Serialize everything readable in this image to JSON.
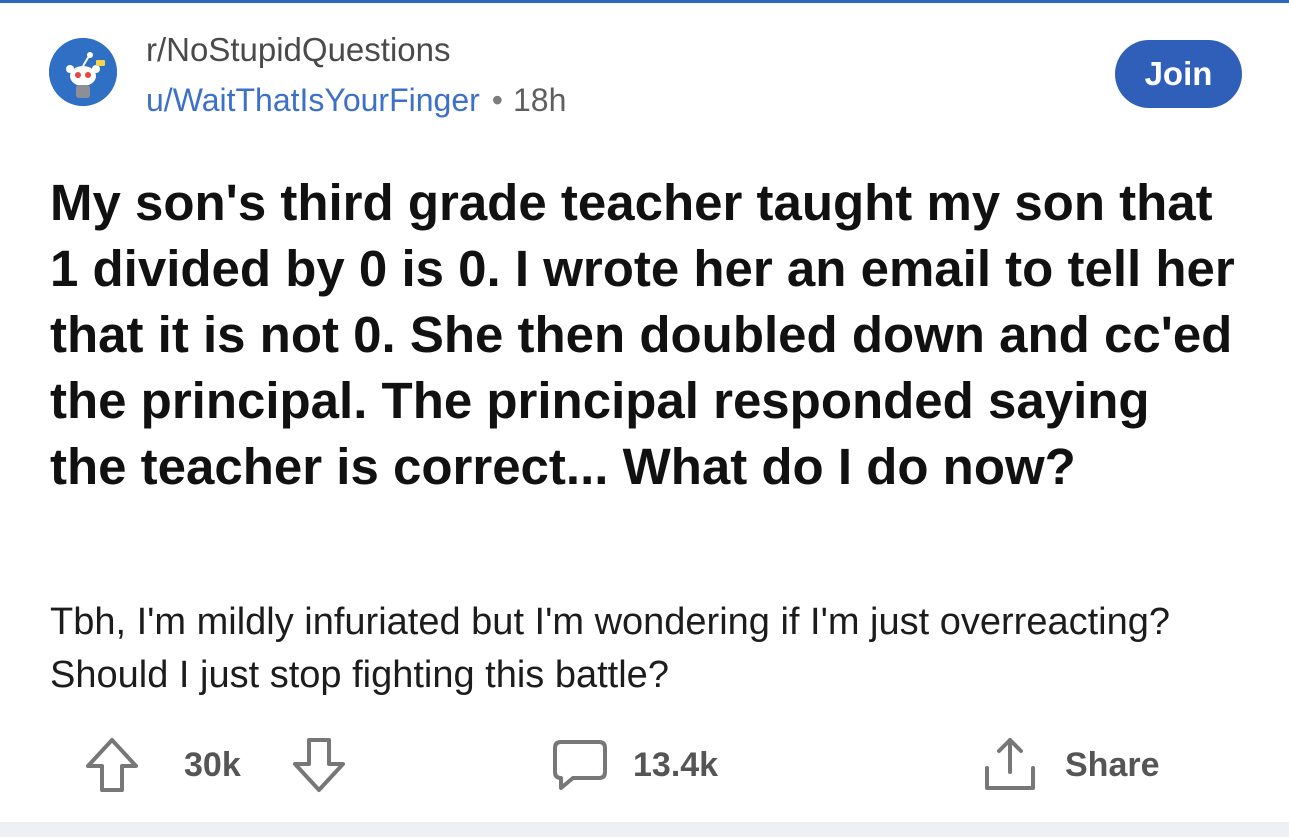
{
  "post": {
    "subreddit": "r/NoStupidQuestions",
    "author": "u/WaitThatIsYourFinger",
    "separator": "•",
    "age": "18h",
    "join_label": "Join",
    "title": "My son's third grade teacher taught my son that 1 divided by 0 is 0. I wrote her an email to tell her that it is not 0. She then doubled down and cc'ed the principal. The principal responded saying the teacher is correct... What do I do now?",
    "body": "Tbh, I'm mildly infuriated but I'm wondering if I'm just overreacting? Should I just stop fighting this battle?"
  },
  "actions": {
    "upvote_count": "30k",
    "comment_count": "13.4k",
    "share_label": "Share"
  },
  "icons": {
    "upvote": "arrow-up-outline-icon",
    "downvote": "arrow-down-outline-icon",
    "comment": "speech-bubble-icon",
    "share": "share-upload-icon"
  },
  "colors": {
    "accent": "#2f5fb8",
    "username": "#3d70c8",
    "avatar_bg": "#2f6fc4"
  }
}
